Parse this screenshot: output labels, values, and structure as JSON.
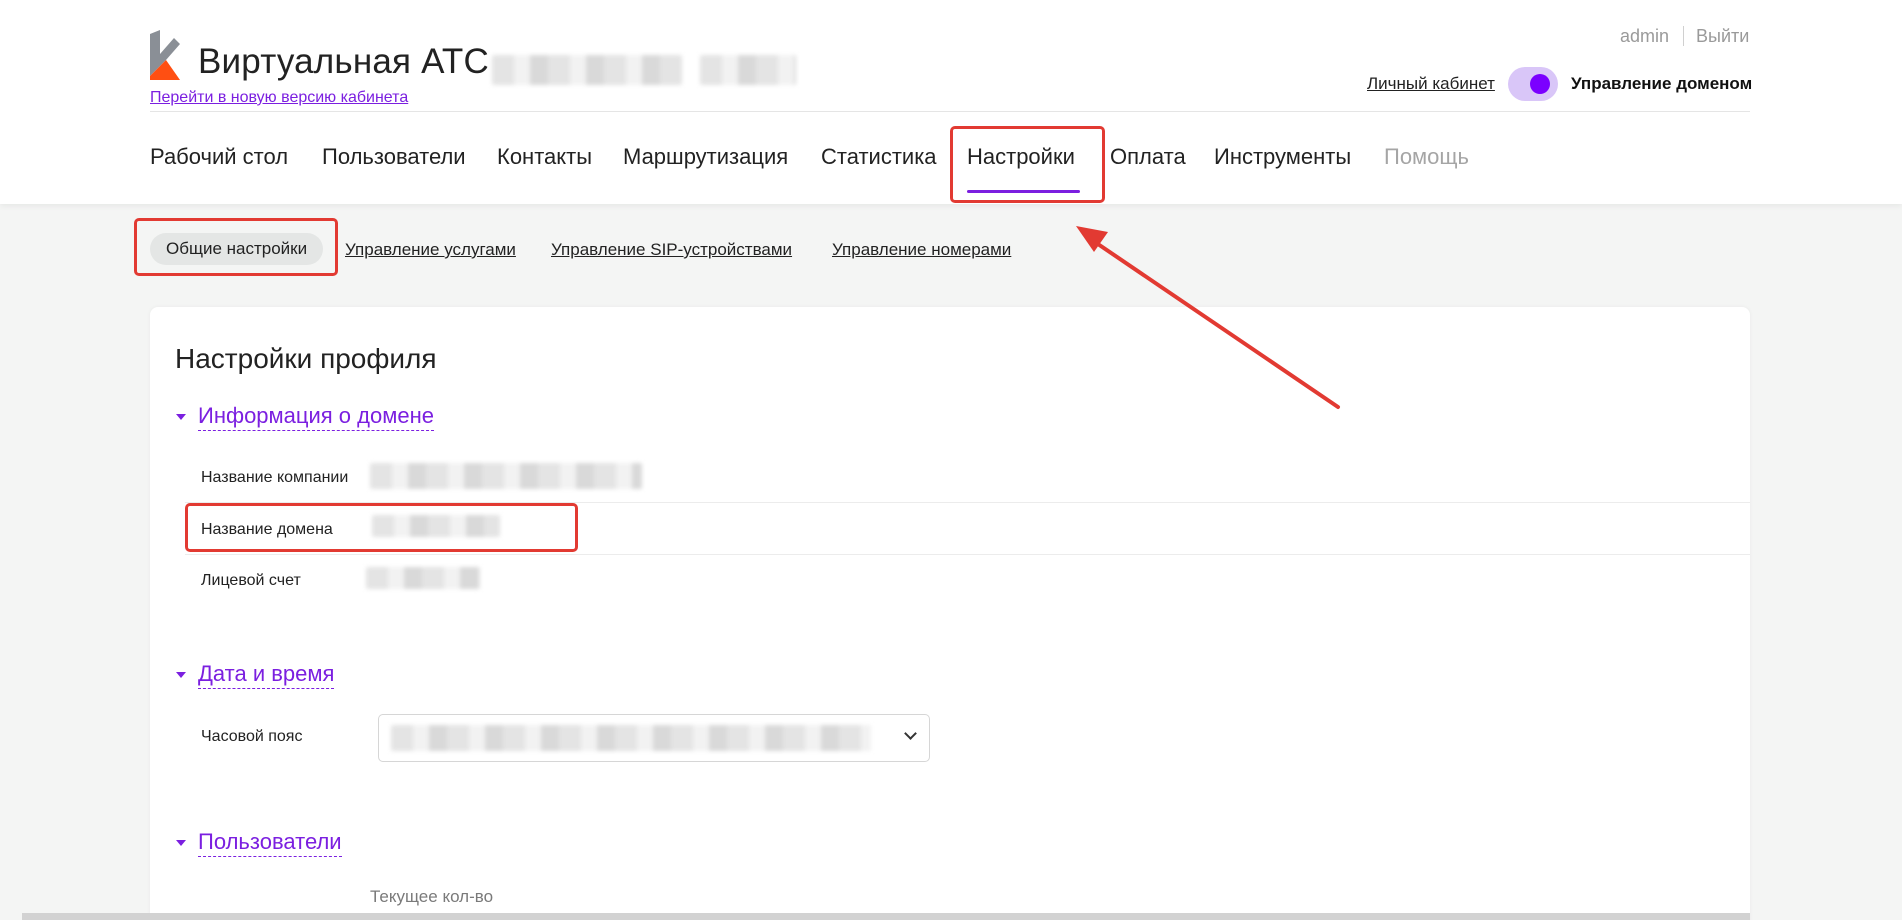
{
  "header": {
    "app_title": "Виртуальная АТС",
    "new_version_link": "Перейти в новую версию кабинета",
    "user": "admin",
    "logout": "Выйти",
    "cabinet_link": "Личный кабинет",
    "domain_mgmt": "Управление доменом",
    "toggle_on": true
  },
  "nav": {
    "items": [
      {
        "label": "Рабочий стол"
      },
      {
        "label": "Пользователи"
      },
      {
        "label": "Контакты"
      },
      {
        "label": "Маршрутизация"
      },
      {
        "label": "Статистика"
      },
      {
        "label": "Настройки",
        "active": true
      },
      {
        "label": "Оплата"
      },
      {
        "label": "Инструменты"
      },
      {
        "label": "Помощь",
        "disabled": true
      }
    ]
  },
  "subtabs": {
    "items": [
      {
        "label": "Общие настройки",
        "active": true
      },
      {
        "label": "Управление услугами"
      },
      {
        "label": "Управление SIP-устройствами"
      },
      {
        "label": "Управление номерами"
      }
    ]
  },
  "profile": {
    "title": "Настройки профиля",
    "domain_info": {
      "title": "Информация о домене",
      "rows": [
        {
          "label": "Название компании"
        },
        {
          "label": "Название домена"
        },
        {
          "label": "Лицевой счет"
        }
      ]
    },
    "datetime": {
      "title": "Дата и время",
      "timezone_label": "Часовой пояс"
    },
    "users": {
      "title": "Пользователи",
      "col_current": "Текущее кол-во"
    }
  },
  "colors": {
    "accent": "#7b1fe0",
    "highlight": "#e23a32",
    "logo_gray": "#8a8f96",
    "logo_orange": "#ff4f12"
  }
}
